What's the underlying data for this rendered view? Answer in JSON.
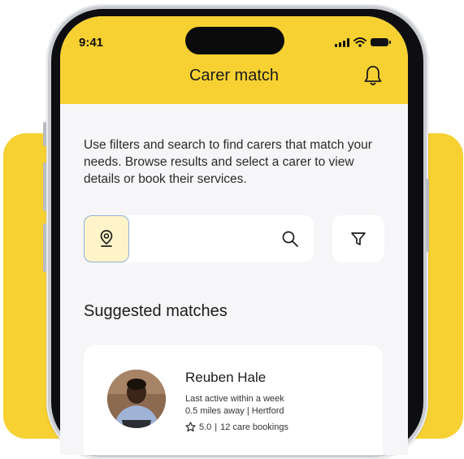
{
  "status_bar": {
    "time": "9:41"
  },
  "header": {
    "title": "Carer match"
  },
  "intro_text": "Use filters and search to find carers that match your needs. Browse results and select a carer to view details or book their services.",
  "search": {
    "value": "",
    "placeholder": ""
  },
  "section_title": "Suggested matches",
  "carer_card": {
    "name": "Reuben Hale",
    "last_active": "Last active within a week",
    "distance": "0.5 miles away",
    "separator": "|",
    "location": "Hertford",
    "rating": "5.0",
    "bookings": "12 care bookings"
  },
  "icons": [
    "signal-icon",
    "wifi-icon",
    "battery-icon",
    "bell-icon",
    "location-pin-icon",
    "search-icon",
    "filter-icon",
    "star-icon"
  ],
  "colors": {
    "brand_yellow": "#f7d132",
    "screen_bg": "#f6f6f8",
    "location_button_bg": "#fff4c9",
    "location_button_border": "#8fb0d9"
  }
}
